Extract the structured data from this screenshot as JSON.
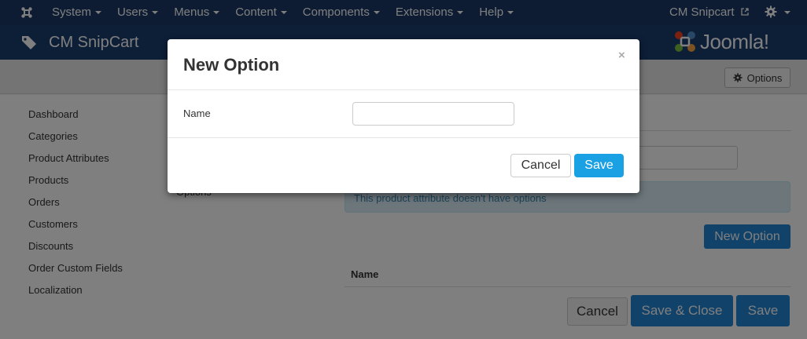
{
  "navbar": {
    "menu": [
      "System",
      "Users",
      "Menus",
      "Content",
      "Components",
      "Extensions",
      "Help"
    ],
    "user_name": "CM Snipcart"
  },
  "header": {
    "title": "CM SnipCart",
    "brand": "Joomla!"
  },
  "toolbar": {
    "options_label": "Options"
  },
  "sidebar": {
    "items": [
      "Dashboard",
      "Categories",
      "Product Attributes",
      "Products",
      "Orders",
      "Customers",
      "Discounts",
      "Order Custom Fields",
      "Localization"
    ]
  },
  "form": {
    "options_label": "Options",
    "alert_text": "This product attribute doesn't have options",
    "new_option_label": "New Option",
    "table_header_name": "Name",
    "cancel_label": "Cancel",
    "save_close_label": "Save & Close",
    "save_label": "Save"
  },
  "modal": {
    "title": "New Option",
    "close_glyph": "×",
    "name_label": "Name",
    "name_value": "",
    "cancel_label": "Cancel",
    "save_label": "Save"
  },
  "colors": {
    "navbar": "#1a3867",
    "header": "#1b3d6e",
    "primary_button": "#2384d3",
    "modal_save": "#1aa1e4",
    "alert_bg": "#d9edf7"
  }
}
